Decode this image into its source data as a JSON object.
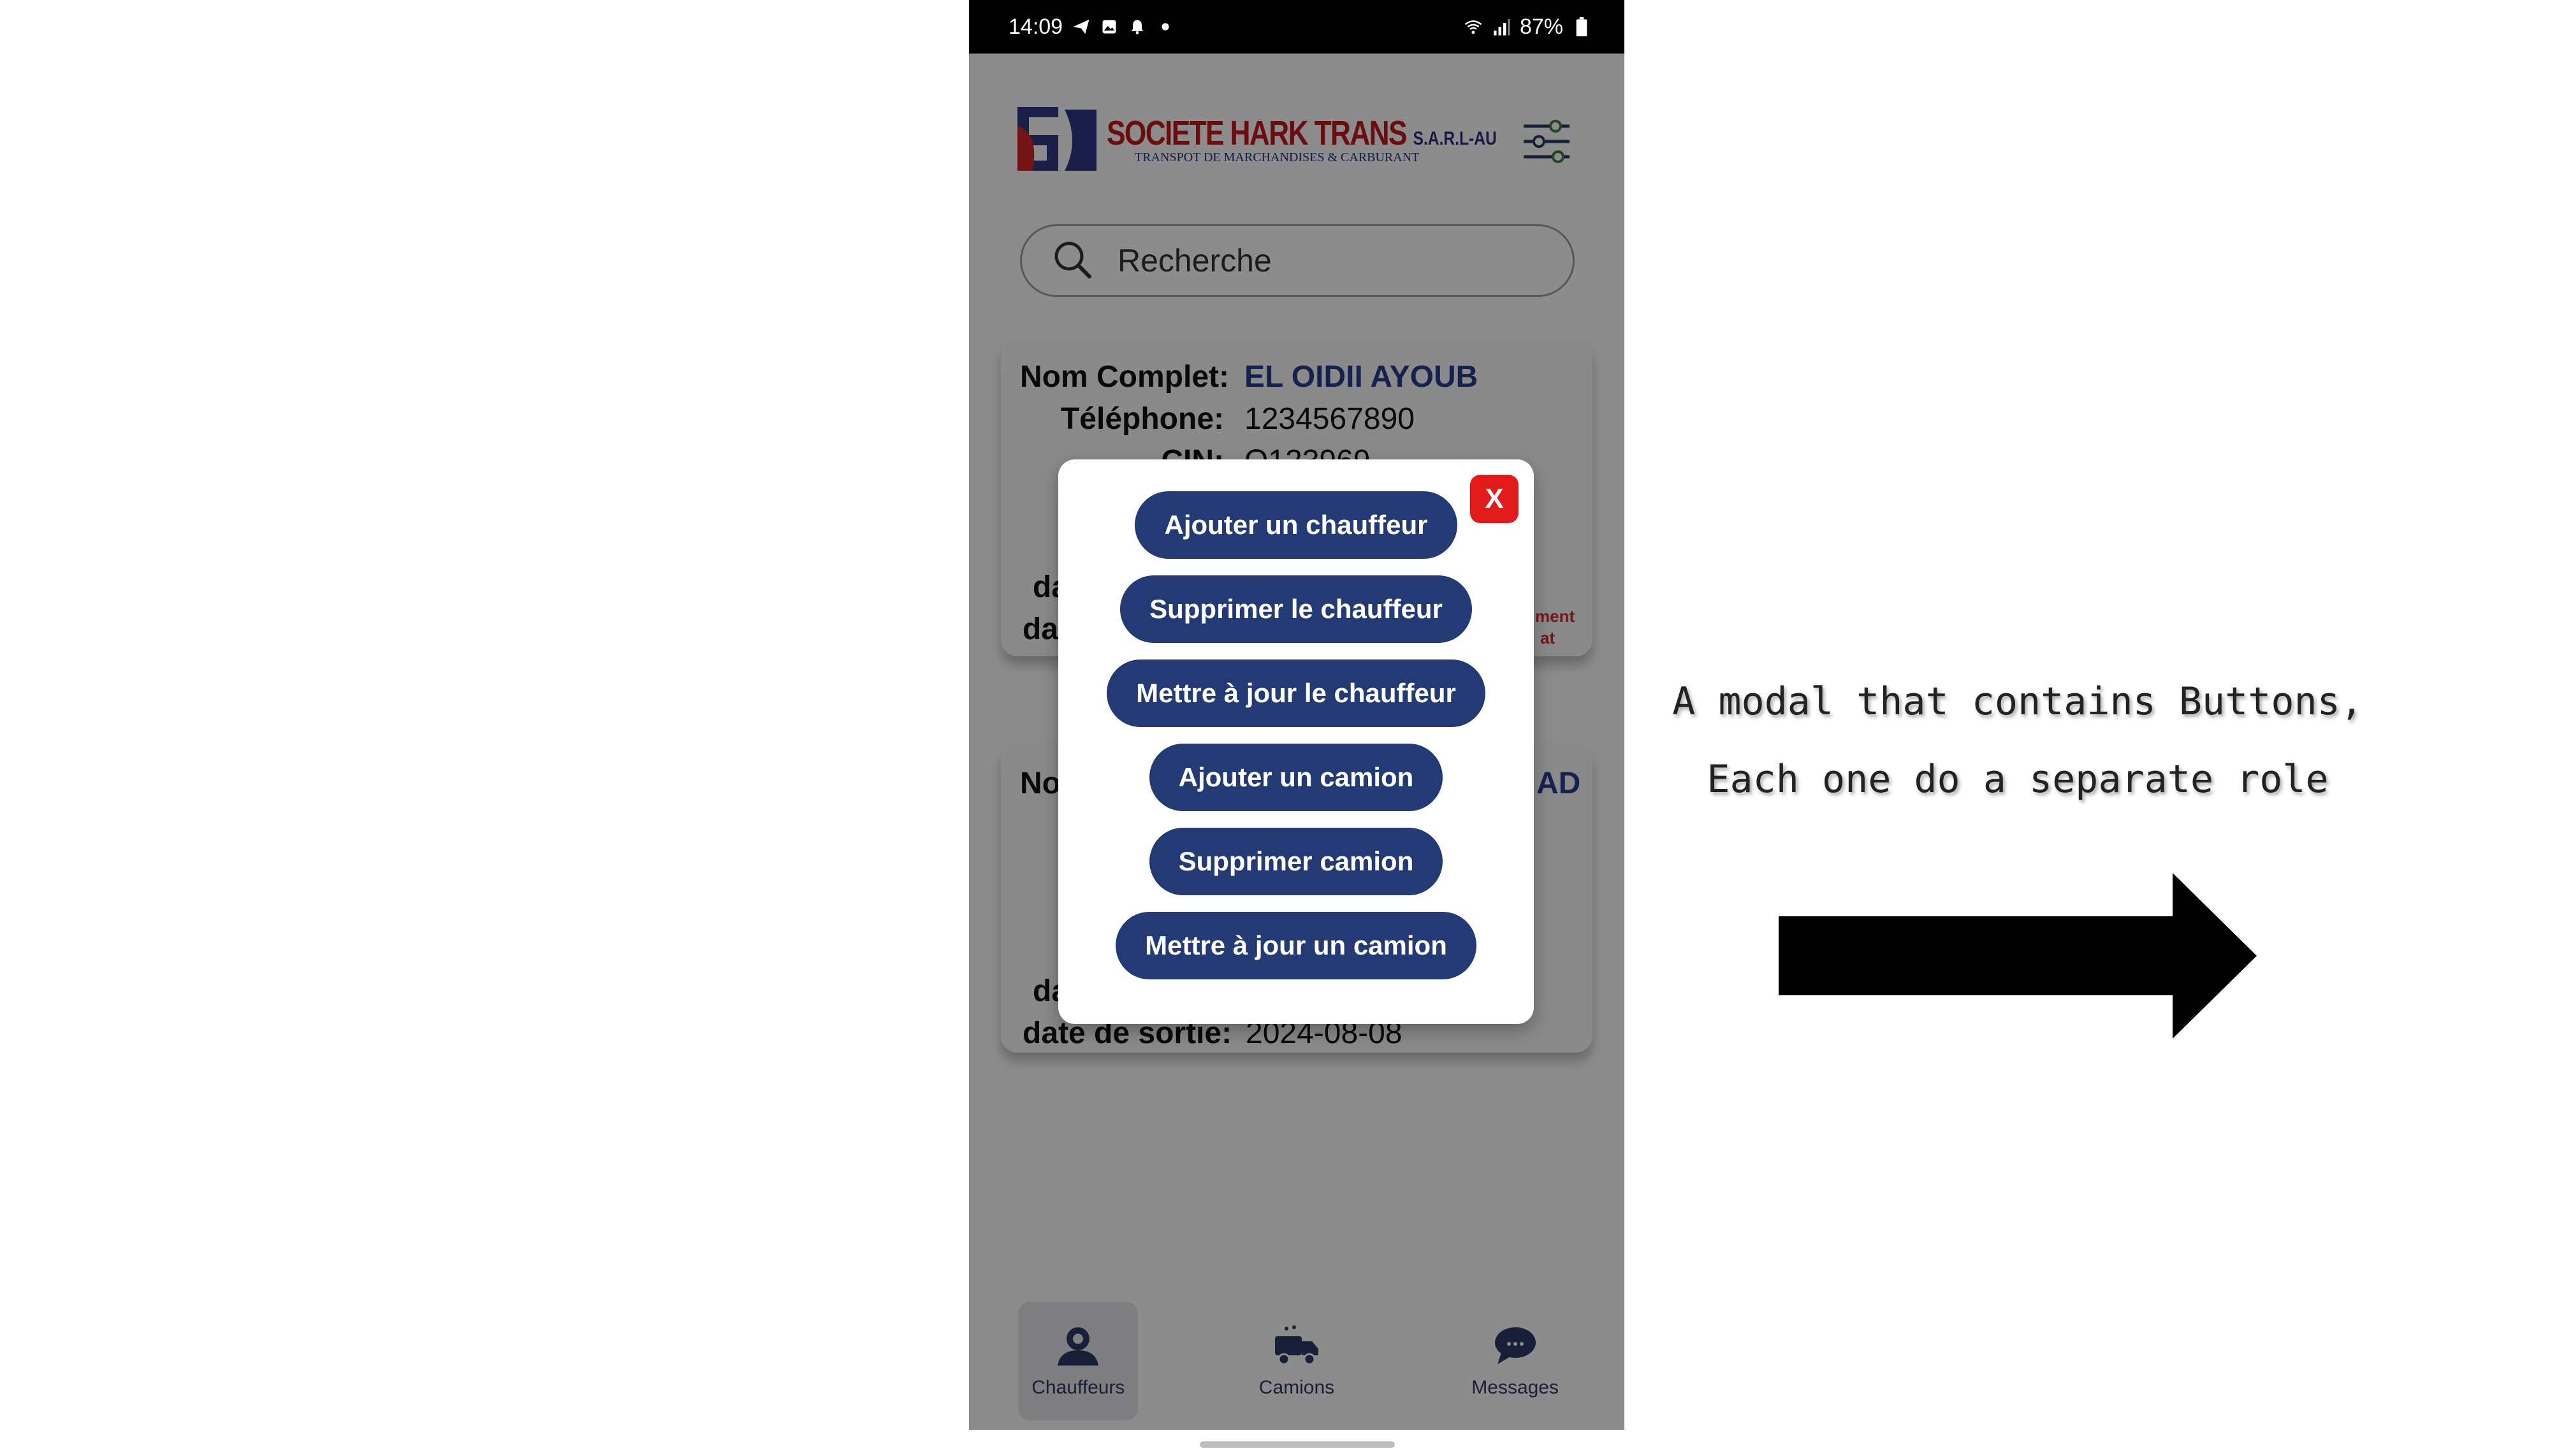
{
  "status_bar": {
    "time": "14:09",
    "battery": "87%"
  },
  "logo": {
    "title": "SOCIETE HARK TRANS",
    "suffix": "S.A.R.L-AU",
    "subtitle": "TRANSPOT DE MARCHANDISES & CARBURANT"
  },
  "search": {
    "placeholder": "Recherche"
  },
  "cards": [
    {
      "name_label": "Nom Complet:",
      "name_value": "EL OIDII AYOUB",
      "phone_label": "Téléphone:",
      "phone_value": "1234567890",
      "cin_label": "CIN:",
      "cin_value": "Q123969",
      "row4_fragment": "da",
      "row5_fragment": "da",
      "action1_fragment": "ment",
      "action2_fragment": "at"
    },
    {
      "name_fragment": "No",
      "value_fragment": "AD",
      "row4_fragment": "da",
      "exit_label": "date de sortie:",
      "exit_value": "2024-08-08"
    }
  ],
  "modal": {
    "close_label": "X",
    "buttons": [
      "Ajouter un chauffeur",
      "Supprimer le chauffeur",
      "Mettre à jour le chauffeur",
      "Ajouter un camion",
      "Supprimer camion",
      "Mettre à jour un camion"
    ]
  },
  "nav": [
    {
      "label": "Chauffeurs",
      "icon": "drivers-icon",
      "active": true
    },
    {
      "label": "Camions",
      "icon": "truck-icon",
      "active": false
    },
    {
      "label": "Messages",
      "icon": "chat-icon",
      "active": false
    }
  ],
  "annotation": {
    "line1": "A modal that contains Buttons,",
    "line2": "Each one do a separate role"
  },
  "colors": {
    "primary": "#243a74",
    "close": "#e11a1a",
    "accent_text": "#2b3d8f"
  }
}
